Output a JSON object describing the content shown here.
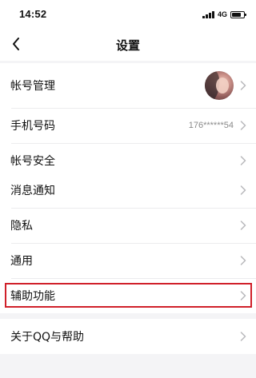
{
  "status_bar": {
    "time": "14:52",
    "network": "4G",
    "icons": [
      "signal-icon",
      "battery-icon"
    ]
  },
  "nav": {
    "title": "设置",
    "back_icon": "chevron-left-icon"
  },
  "groups": [
    {
      "items": [
        {
          "label": "帐号管理",
          "trailing": "avatar"
        },
        {
          "label": "手机号码",
          "value": "176******54"
        },
        {
          "label": "帐号安全"
        }
      ]
    },
    {
      "items": [
        {
          "label": "消息通知"
        },
        {
          "label": "隐私"
        },
        {
          "label": "通用"
        },
        {
          "label": "辅助功能",
          "highlighted": true
        }
      ]
    },
    {
      "items": [
        {
          "label": "关于QQ与帮助"
        }
      ]
    }
  ],
  "colors": {
    "background": "#f4f4f6",
    "surface": "#ffffff",
    "highlight": "#d0202a",
    "chevron": "#b8b8bc",
    "secondary_text": "#8a8a8a"
  }
}
